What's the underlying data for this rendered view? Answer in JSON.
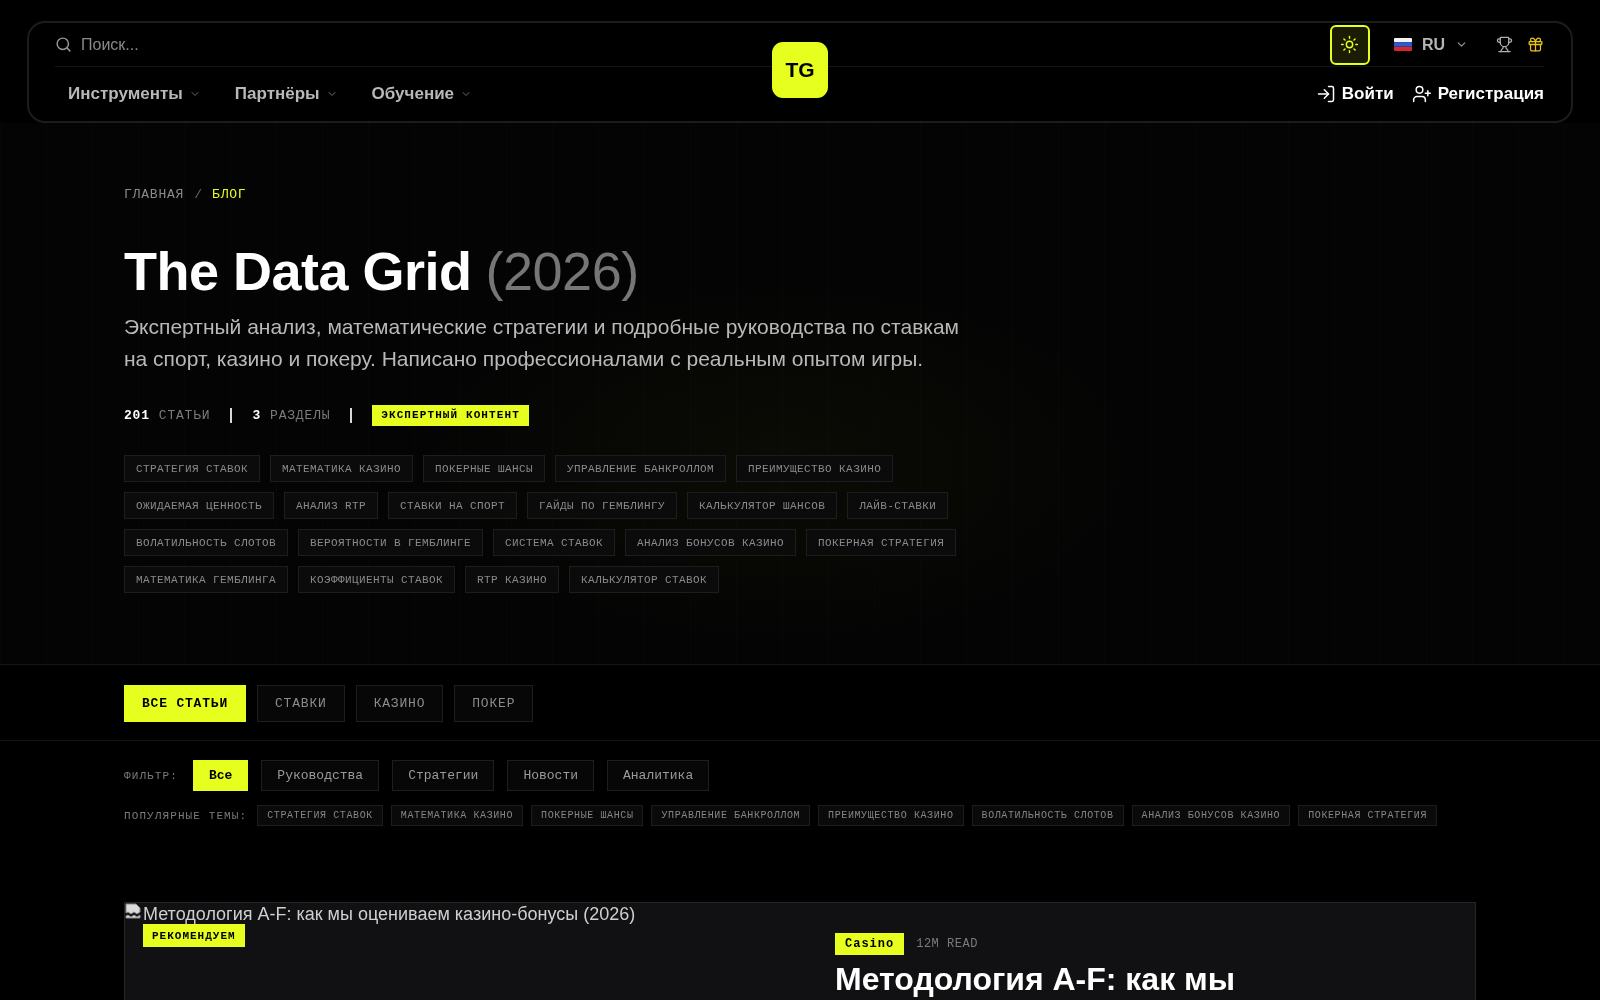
{
  "header": {
    "search": {
      "placeholder": "Поиск..."
    },
    "logo": "TG",
    "language": "RU",
    "nav": [
      {
        "label": "Инструменты"
      },
      {
        "label": "Партнёры"
      },
      {
        "label": "Обучение"
      }
    ],
    "auth": [
      {
        "kind": "login",
        "label": "Войти"
      },
      {
        "kind": "register",
        "label": "Регистрация"
      }
    ]
  },
  "breadcrumb": {
    "separator": "/",
    "items": [
      {
        "label": "ГЛАВНАЯ",
        "current": false
      },
      {
        "label": "БЛОГ",
        "current": true
      }
    ]
  },
  "hero": {
    "title": "The Data Grid",
    "year": "(2026)",
    "description": "Экспертный анализ, математические стратегии и подробные руководства по ставкам на спорт, казино и покеру. Написано профессионалами с реальным опытом игры.",
    "stats": [
      {
        "value": "201",
        "label": "СТАТЬИ"
      },
      {
        "value": "3",
        "label": "РАЗДЕЛЫ"
      }
    ],
    "badge": "ЭКСПЕРТНЫЙ КОНТЕНТ",
    "tag_rows": [
      [
        "СТРАТЕГИЯ СТАВОК",
        "МАТЕМАТИКА КАЗИНО",
        "ПОКЕРНЫЕ ШАНСЫ",
        "УПРАВЛЕНИЕ БАНКРОЛЛОМ",
        "ПРЕИМУЩЕСТВО КАЗИНО"
      ],
      [
        "ОЖИДАЕМАЯ ЦЕННОСТЬ",
        "АНАЛИЗ RTP",
        "СТАВКИ НА СПОРТ",
        "ГАЙДЫ ПО ГЕМБЛИНГУ",
        "КАЛЬКУЛЯТОР ШАНСОВ",
        "ЛАЙВ-СТАВКИ"
      ],
      [
        "ВОЛАТИЛЬНОСТЬ СЛОТОВ",
        "ВЕРОЯТНОСТИ В ГЕМБЛИНГЕ",
        "СИСТЕМА СТАВОК",
        "АНАЛИЗ БОНУСОВ КАЗИНО",
        "ПОКЕРНАЯ СТРАТЕГИЯ"
      ],
      [
        "МАТЕМАТИКА ГЕМБЛИНГА",
        "КОЭФФИЦИЕНТЫ СТАВОК",
        "RTP КАЗИНО",
        "КАЛЬКУЛЯТОР СТАВОК"
      ]
    ]
  },
  "category_tabs": [
    {
      "label": "ВСЕ СТАТЬИ",
      "selected": true
    },
    {
      "label": "СТАВКИ",
      "selected": false
    },
    {
      "label": "КАЗИНО",
      "selected": false
    },
    {
      "label": "ПОКЕР",
      "selected": false
    }
  ],
  "filter": {
    "label": "ФИЛЬТР:",
    "options": [
      {
        "label": "Все",
        "selected": true
      },
      {
        "label": "Руководства",
        "selected": false
      },
      {
        "label": "Стратегии",
        "selected": false
      },
      {
        "label": "Новости",
        "selected": false
      },
      {
        "label": "Аналитика",
        "selected": false
      }
    ]
  },
  "popular_topics": {
    "label": "ПОПУЛЯРНЫЕ ТЕМЫ:",
    "topics": [
      "СТРАТЕГИЯ СТАВОК",
      "МАТЕМАТИКА КАЗИНО",
      "ПОКЕРНЫЕ ШАНСЫ",
      "УПРАВЛЕНИЕ БАНКРОЛЛОМ",
      "ПРЕИМУЩЕСТВО КАЗИНО",
      "ВОЛАТИЛЬНОСТЬ СЛОТОВ",
      "АНАЛИЗ БОНУСОВ КАЗИНО",
      "ПОКЕРНАЯ СТРАТЕГИЯ"
    ]
  },
  "featured_article": {
    "image_alt": "Методология A-F: как мы оцениваем казино-бонусы (2026)",
    "badge": "РЕКОМЕНДУЕМ",
    "category": "Casino",
    "read_time": "12M READ",
    "title": "Методология A-F: как мы"
  }
}
